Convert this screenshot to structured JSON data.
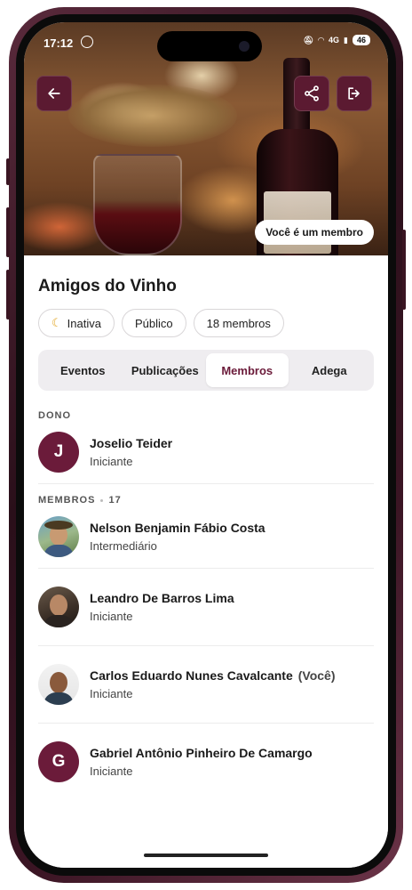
{
  "status_bar": {
    "time": "17:12",
    "network": "4G",
    "battery": "46"
  },
  "header": {
    "back_icon": "arrow-left-icon",
    "share_icon": "share-icon",
    "leave_icon": "logout-icon",
    "member_badge": "Você é um membro",
    "accent": "#5b1a31"
  },
  "group": {
    "title": "Amigos do Vinho",
    "chips": [
      {
        "label": "Inativa",
        "icon": "moon-icon"
      },
      {
        "label": "Público"
      },
      {
        "label": "18 membros"
      }
    ]
  },
  "tabs": [
    {
      "label": "Eventos"
    },
    {
      "label": "Publicações"
    },
    {
      "label": "Membros",
      "active": true
    },
    {
      "label": "Adega"
    }
  ],
  "owner_section": {
    "label": "DONO",
    "owner": {
      "initial": "J",
      "name": "Joselio Teider",
      "level": "Iniciante"
    }
  },
  "members_section": {
    "label": "MEMBROS",
    "count": "17",
    "members": [
      {
        "name": "Nelson Benjamin Fábio Costa",
        "level": "Intermediário",
        "avatar": "photo"
      },
      {
        "name": "Leandro De Barros Lima",
        "level": "Iniciante",
        "avatar": "photo"
      },
      {
        "name": "Carlos Eduardo Nunes Cavalcante",
        "you_tag": "(Você)",
        "level": "Iniciante",
        "avatar": "photo"
      },
      {
        "name": "Gabriel Antônio Pinheiro De Camargo",
        "level": "Iniciante",
        "initial": "G"
      }
    ]
  }
}
